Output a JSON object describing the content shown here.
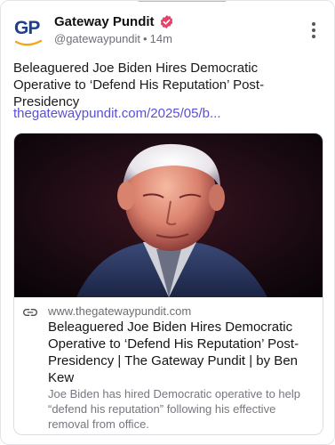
{
  "post": {
    "author": {
      "name": "Gateway Pundit",
      "handle": "@gatewaypundit",
      "time": "14m",
      "avatar_text": "GP",
      "verified": true
    },
    "text": "Beleaguered Joe Biden Hires Democratic Operative to ‘Defend His Reputation’ Post-Presidency",
    "link_text": "thegatewaypundit.com/2025/05/b...",
    "card": {
      "domain": "www.thegatewaypundit.com",
      "title": "Beleaguered Joe Biden Hires Democratic Operative to ‘Defend His Reputation’ Post-Presidency | The Gateway Pundit | by Ben Kew",
      "description": "Joe Biden has hired Democratic operative to help “defend his reputation” following his effective removal from office."
    }
  },
  "icons": {
    "verified": "verified-badge-icon",
    "more": "kebab-menu-icon",
    "link": "link-chain-icon"
  },
  "colors": {
    "accent": "#5b4fd6",
    "verified": "#e5426a",
    "brand": "#1d3f8c"
  }
}
